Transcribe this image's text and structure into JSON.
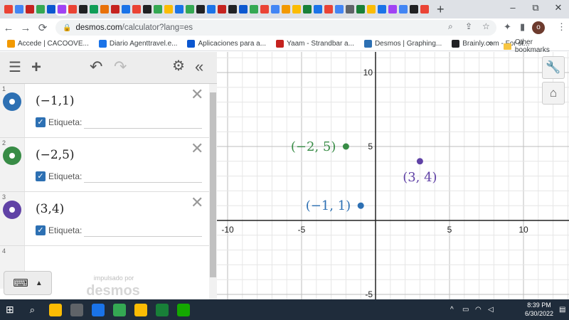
{
  "browser": {
    "tab_favicon_colors": [
      "#ea4335",
      "#4285f4",
      "#c5221f",
      "#34a853",
      "#0b57d0",
      "#a142f4",
      "#ea4335",
      "#202124",
      "#0f9d58",
      "#e8710a",
      "#c5221f",
      "#1a73e8",
      "#ea4335",
      "#202124",
      "#34a853",
      "#fbbc04",
      "#1a73e8",
      "#34a853",
      "#202124",
      "#1a73e8",
      "#c5221f",
      "#202124",
      "#0b57d0",
      "#34a853",
      "#ea4335",
      "#4285f4",
      "#f29900",
      "#fbbc04",
      "#188038",
      "#1a73e8",
      "#ea4335",
      "#4285f4",
      "#5f6368",
      "#188038",
      "#fbbc04",
      "#1a73e8",
      "#a142f4",
      "#4285f4",
      "#202124",
      "#ea4335"
    ],
    "new_tab_label": "+",
    "minimize": "–",
    "restore": "⧉",
    "close": "✕",
    "url_domain": "desmos.com",
    "url_path": "/calculator?lang=es",
    "profile_initial": "o"
  },
  "bookmarks": [
    {
      "label": "Accede | CACOOVE...",
      "color": "#f29900"
    },
    {
      "label": "Diario Agenttravel.e...",
      "color": "#1a73e8"
    },
    {
      "label": "Aplicaciones para a...",
      "color": "#0b57d0"
    },
    {
      "label": "Yaam - Strandbar a...",
      "color": "#c5221f"
    },
    {
      "label": "Desmos | Graphing...",
      "color": "#2d70b3"
    },
    {
      "label": "Brainly.com - For st...",
      "color": "#202124"
    }
  ],
  "bookmarks_more": "»",
  "other_bookmarks": "Other bookmarks",
  "expressions": [
    {
      "num": "1",
      "latex": "(−1,1)",
      "color": "#2d70b3",
      "label": "Etiqueta:"
    },
    {
      "num": "2",
      "latex": "(−2,5)",
      "color": "#388c46",
      "label": "Etiqueta:"
    },
    {
      "num": "3",
      "latex": "(3,4)",
      "color": "#6042a6",
      "label": "Etiqueta:"
    }
  ],
  "empty_row_num": "4",
  "powered_by": "impulsado por",
  "powered_logo": "desmos",
  "graph": {
    "x_ticks": [
      "-10",
      "-5",
      "5",
      "10"
    ],
    "y_ticks": [
      "10",
      "5",
      "-5"
    ],
    "points": [
      {
        "x": -1,
        "y": 1,
        "label": "(−1, 1)",
        "color": "#2d70b3"
      },
      {
        "x": -2,
        "y": 5,
        "label": "(−2, 5)",
        "color": "#388c46"
      },
      {
        "x": 3,
        "y": 4,
        "label": "(3, 4)",
        "color": "#6042a6"
      }
    ]
  },
  "taskbar": {
    "app_colors": [
      "#fbbc04",
      "#5f6368",
      "#1a73e8",
      "#34a853",
      "#fbbc04",
      "#188038",
      "#14a800"
    ],
    "time": "8:39 PM",
    "date": "6/30/2022"
  }
}
